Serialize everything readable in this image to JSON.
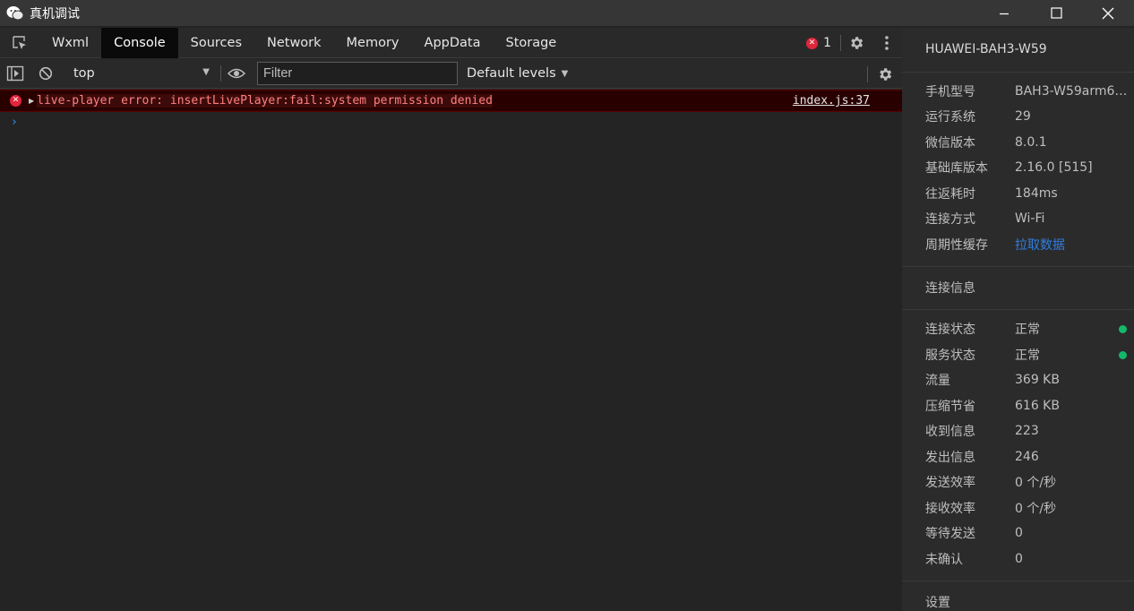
{
  "window": {
    "title": "真机调试"
  },
  "tabs": [
    {
      "label": "Wxml"
    },
    {
      "label": "Console"
    },
    {
      "label": "Sources"
    },
    {
      "label": "Network"
    },
    {
      "label": "Memory"
    },
    {
      "label": "AppData"
    },
    {
      "label": "Storage"
    }
  ],
  "active_tab": "Console",
  "error_count": "1",
  "toolbar": {
    "context": "top",
    "filter_placeholder": "Filter",
    "levels": "Default levels"
  },
  "console": {
    "messages": [
      {
        "level": "error",
        "text": "live-player error: insertLivePlayer:fail:system permission denied",
        "source": "index.js:37"
      }
    ],
    "prompt": "›"
  },
  "device": {
    "name": "HUAWEI-BAH3-W59",
    "info": [
      {
        "key": "手机型号",
        "value": "BAH3-W59arm6…"
      },
      {
        "key": "运行系统",
        "value": "29"
      },
      {
        "key": "微信版本",
        "value": "8.0.1"
      },
      {
        "key": "基础库版本",
        "value": "2.16.0 [515]"
      },
      {
        "key": "往返耗时",
        "value": "184ms"
      },
      {
        "key": "连接方式",
        "value": "Wi-Fi"
      },
      {
        "key": "周期性缓存",
        "value": "拉取数据"
      }
    ]
  },
  "connection": {
    "title": "连接信息",
    "items": [
      {
        "key": "连接状态",
        "value": "正常"
      },
      {
        "key": "服务状态",
        "value": "正常"
      },
      {
        "key": "流量",
        "value": "369 KB"
      },
      {
        "key": "压缩节省",
        "value": "616 KB"
      },
      {
        "key": "收到信息",
        "value": "223"
      },
      {
        "key": "发出信息",
        "value": "246"
      },
      {
        "key": "发送效率",
        "value": "0 个/秒"
      },
      {
        "key": "接收效率",
        "value": "0 个/秒"
      },
      {
        "key": "等待发送",
        "value": "0"
      },
      {
        "key": "未确认",
        "value": "0"
      }
    ]
  },
  "settings": {
    "title": "设置"
  },
  "colors": {
    "error": "#e0263b",
    "status_ok": "#14b86a",
    "link": "#2f7de1"
  }
}
